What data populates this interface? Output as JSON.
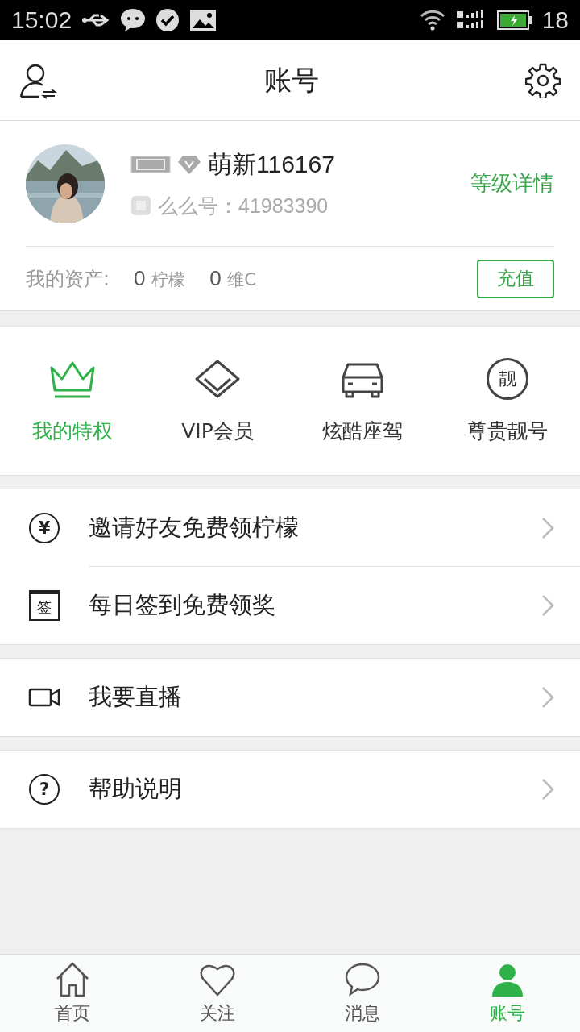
{
  "status_bar": {
    "time": "15:02",
    "battery": "18"
  },
  "header": {
    "title": "账号"
  },
  "profile": {
    "name": "萌新116167",
    "id_label": "么么号：",
    "id_value": "41983390",
    "level_link": "等级详情",
    "assets_label": "我的资产:",
    "assets": [
      {
        "amount": "0",
        "unit": "柠檬"
      },
      {
        "amount": "0",
        "unit": "维C"
      }
    ],
    "recharge": "充值"
  },
  "privileges": [
    {
      "kind": "crown",
      "label": "我的特权",
      "selected": true
    },
    {
      "kind": "diamond",
      "label": "VIP会员",
      "selected": false
    },
    {
      "kind": "car",
      "label": "炫酷座驾",
      "selected": false
    },
    {
      "kind": "badge",
      "label": "尊贵靓号",
      "badge_text": "靓",
      "selected": false
    }
  ],
  "menu_groups": [
    [
      {
        "kind": "coin",
        "label": "邀请好友免费领柠檬",
        "icon_text": "¥"
      },
      {
        "kind": "calendar",
        "label": "每日签到免费领奖",
        "icon_text": "签"
      }
    ],
    [
      {
        "kind": "video",
        "label": "我要直播"
      }
    ],
    [
      {
        "kind": "help",
        "label": "帮助说明",
        "icon_text": "?"
      }
    ]
  ],
  "tabs": [
    {
      "kind": "home",
      "label": "首页",
      "selected": false
    },
    {
      "kind": "heart",
      "label": "关注",
      "selected": false
    },
    {
      "kind": "chat",
      "label": "消息",
      "selected": false
    },
    {
      "kind": "person",
      "label": "账号",
      "selected": true
    }
  ]
}
